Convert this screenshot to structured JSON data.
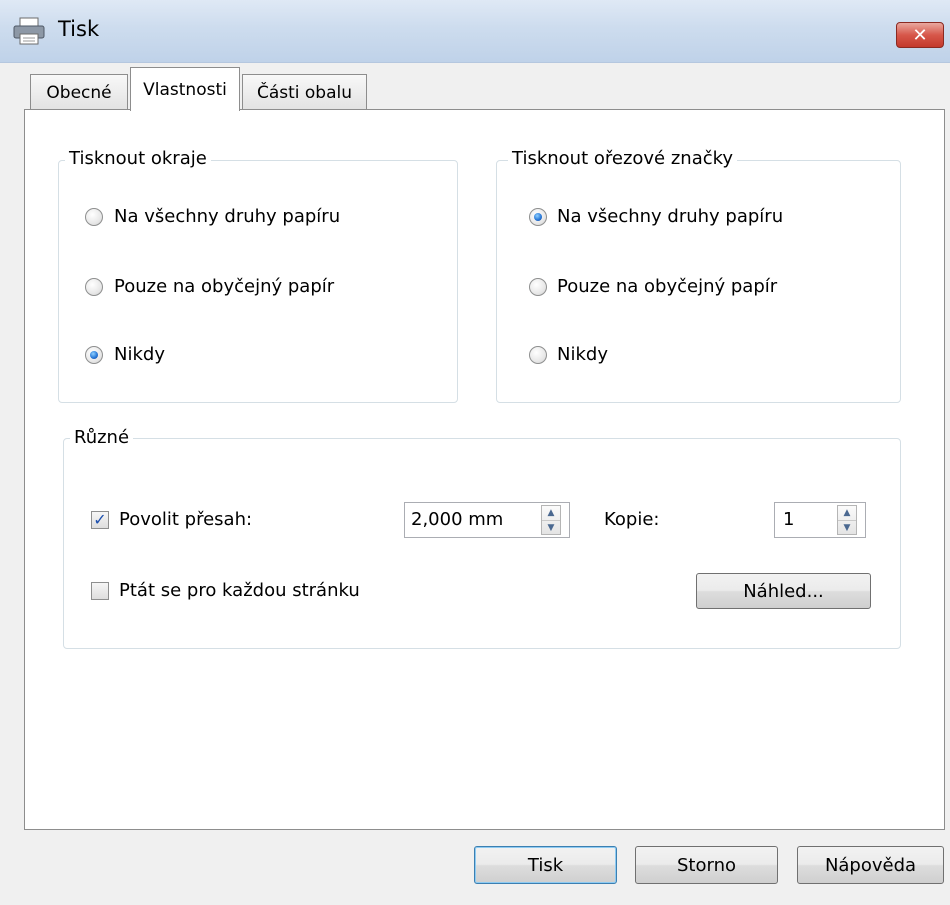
{
  "window": {
    "title": "Tisk",
    "icon": "printer-icon",
    "close_glyph": "✕"
  },
  "tabs": [
    {
      "label": "Obecné",
      "active": false
    },
    {
      "label": "Vlastnosti",
      "active": true
    },
    {
      "label": "Části obalu",
      "active": false
    }
  ],
  "print_margins": {
    "legend": "Tisknout okraje",
    "options": [
      {
        "label": "Na všechny druhy papíru",
        "checked": false
      },
      {
        "label": "Pouze na obyčejný papír",
        "checked": false
      },
      {
        "label": "Nikdy",
        "checked": true
      }
    ]
  },
  "crop_marks": {
    "legend": "Tisknout ořezové značky",
    "options": [
      {
        "label": "Na všechny druhy papíru",
        "checked": true
      },
      {
        "label": "Pouze na obyčejný papír",
        "checked": false
      },
      {
        "label": "Nikdy",
        "checked": false
      }
    ]
  },
  "misc": {
    "legend": "Různé",
    "bleed": {
      "label": "Povolit přesah:",
      "checked": true,
      "value": "2,000 mm"
    },
    "copies": {
      "label": "Kopie:",
      "value": "1"
    },
    "ask_each_page": {
      "label": "Ptát se pro každou stránku",
      "checked": false
    },
    "preview_button": "Náhled..."
  },
  "footer": {
    "print_button": "Tisk",
    "cancel_button": "Storno",
    "help_button": "Nápověda"
  },
  "colors": {
    "accent_radio": "#2a7ad8",
    "checkmark": "#1c4fae",
    "close_button": "#c3392c"
  }
}
